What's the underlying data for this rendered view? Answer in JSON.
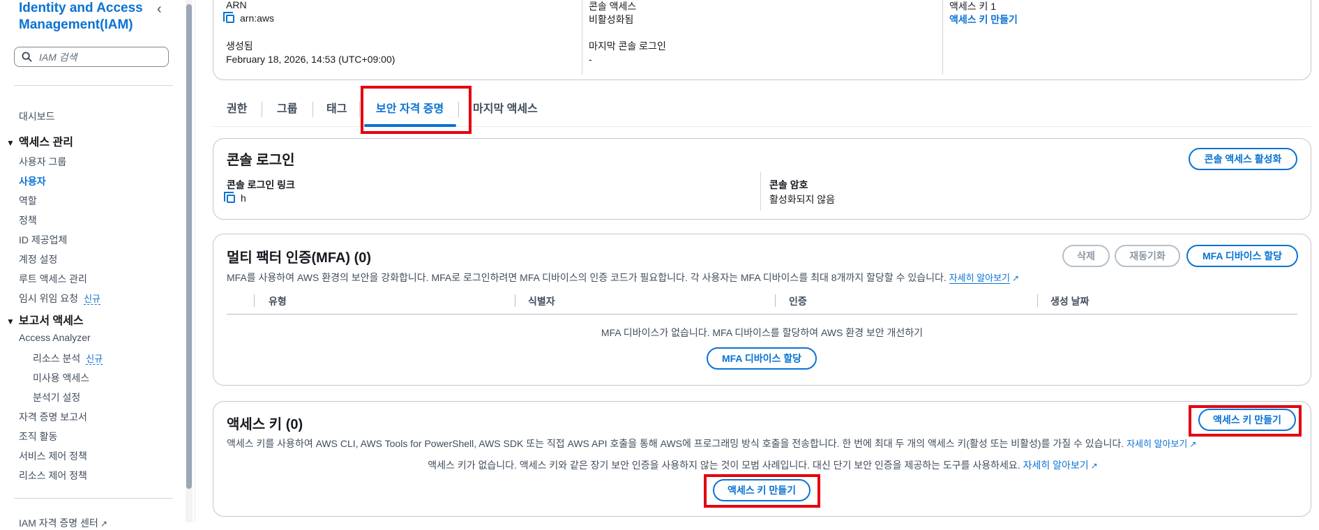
{
  "sidebar": {
    "title": "Identity and Access Management(IAM)",
    "search_placeholder": "IAM 검색",
    "dashboard": "대시보드",
    "access_management": {
      "label": "액세스 관리",
      "items": [
        "사용자 그룹",
        "사용자",
        "역할",
        "정책",
        "ID 제공업체",
        "계정 설정",
        "루트 액세스 관리",
        "임시 위임 요청"
      ],
      "active": "사용자",
      "new_badge_item": "임시 위임 요청"
    },
    "access_reports": {
      "label": "보고서 액세스",
      "access_analyzer": "Access Analyzer",
      "sub_items": [
        "리소스 분석",
        "미사용 액세스",
        "분석기 설정"
      ],
      "items": [
        "자격 증명 보고서",
        "조직 활동",
        "서비스 제어 정책",
        "리소스 제어 정책"
      ]
    },
    "new_badge": "신규",
    "iam_identity_center": "IAM 자격 증명 센터"
  },
  "summary": {
    "arn_label": "ARN",
    "arn_value": "arn:aws",
    "created_label": "생성됨",
    "created_value": "February 18, 2026, 14:53 (UTC+09:00)",
    "console_access_label": "콘솔 액세스",
    "console_access_value": "비활성화됨",
    "last_login_label": "마지막 콘솔 로그인",
    "last_login_value": "-",
    "access_key_label": "액세스 키 1",
    "access_key_link": "액세스 키 만들기"
  },
  "tabs": [
    "권한",
    "그룹",
    "태그",
    "보안 자격 증명",
    "마지막 액세스"
  ],
  "active_tab": "보안 자격 증명",
  "console_login": {
    "title": "콘솔 로그인",
    "enable_button": "콘솔 액세스 활성화",
    "link_label": "콘솔 로그인 링크",
    "link_value": "h",
    "password_label": "콘솔 암호",
    "password_value": "활성화되지 않음"
  },
  "mfa": {
    "title": "멀티 팩터 인증(MFA) (0)",
    "description": "MFA를 사용하여 AWS 환경의 보안을 강화합니다. MFA로 로그인하려면 MFA 디바이스의 인증 코드가 필요합니다. 각 사용자는 MFA 디바이스를 최대 8개까지 할당할 수 있습니다.",
    "learn_more": "자세히 알아보기",
    "delete_button": "삭제",
    "resync_button": "재동기화",
    "assign_button": "MFA 디바이스 할당",
    "columns": [
      "유형",
      "식별자",
      "인증",
      "생성 날짜"
    ],
    "empty_text": "MFA 디바이스가 없습니다. MFA 디바이스를 할당하여 AWS 환경 보안 개선하기",
    "empty_button": "MFA 디바이스 할당"
  },
  "access_keys": {
    "title": "액세스 키 (0)",
    "create_button": "액세스 키 만들기",
    "description": "액세스 키를 사용하여 AWS CLI, AWS Tools for PowerShell, AWS SDK 또는 직접 AWS API 호출을 통해 AWS에 프로그래밍 방식 호출을 전송합니다. 한 번에 최대 두 개의 액세스 키(활성 또는 비활성)를 가질 수 있습니다.",
    "learn_more": "자세히 알아보기",
    "empty_text": "액세스 키가 없습니다. 액세스 키와 같은 장기 보안 인증을 사용하지 않는 것이 모범 사례입니다. 대신 단기 보안 인증을 제공하는 도구를 사용하세요.",
    "empty_learn_more": "자세히 알아보기",
    "empty_button": "액세스 키 만들기"
  },
  "colors": {
    "accent": "#0972d3",
    "highlight": "#e3000f",
    "border": "#c6c6cd"
  }
}
